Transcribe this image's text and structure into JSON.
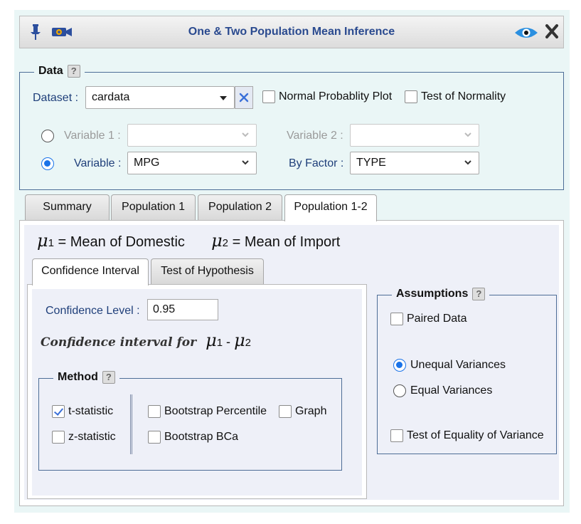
{
  "window": {
    "title": "One & Two Population Mean Inference"
  },
  "data_section": {
    "legend": "Data",
    "help": "?",
    "dataset_label": "Dataset :",
    "dataset_value": "cardata",
    "normal_plot_label": "Normal Probablity Plot",
    "normal_plot_checked": false,
    "normality_test_label": "Test of Normality",
    "normality_test_checked": false,
    "variable1_label": "Variable 1 :",
    "variable1_value": "",
    "variable2_label": "Variable 2 :",
    "variable2_value": "",
    "variable_label": "Variable :",
    "variable_value": "MPG",
    "by_factor_label": "By Factor :",
    "by_factor_value": "TYPE"
  },
  "tabs": [
    {
      "label": "Summary",
      "active": false
    },
    {
      "label": "Population 1",
      "active": false
    },
    {
      "label": "Population 2",
      "active": false
    },
    {
      "label": "Population 1-2",
      "active": true
    }
  ],
  "means": {
    "mu1_sub": "1",
    "mu1_text": "= Mean of Domestic",
    "mu2_sub": "2",
    "mu2_text": "= Mean of Import"
  },
  "subtabs": [
    {
      "label": "Confidence Interval",
      "active": true
    },
    {
      "label": "Test of Hypothesis",
      "active": false
    }
  ],
  "ci": {
    "confidence_label": "Confidence Level :",
    "confidence_value": "0.95",
    "heading": "Confidence interval for",
    "mu1_sub": "1",
    "minus": "-",
    "mu2_sub": "2"
  },
  "method": {
    "legend": "Method",
    "help": "?",
    "t_stat": "t-statistic",
    "t_stat_checked": true,
    "z_stat": "z-statistic",
    "z_stat_checked": false,
    "bootstrap_percentile": "Bootstrap Percentile",
    "bootstrap_bca": "Bootstrap BCa",
    "graph": "Graph"
  },
  "assumptions": {
    "legend": "Assumptions",
    "help": "?",
    "paired": "Paired Data",
    "unequal": "Unequal Variances",
    "equal": "Equal Variances",
    "equality_test": "Test of Equality of Variance"
  },
  "colors": {
    "title_blue": "#2a4a8f",
    "label_blue": "#1f3f7a",
    "radio_blue": "#1a73e8",
    "panel_bg": "#eaf6f6",
    "inner_bg": "#eef0f8",
    "clear_button_icon": "#3a6fd8"
  }
}
